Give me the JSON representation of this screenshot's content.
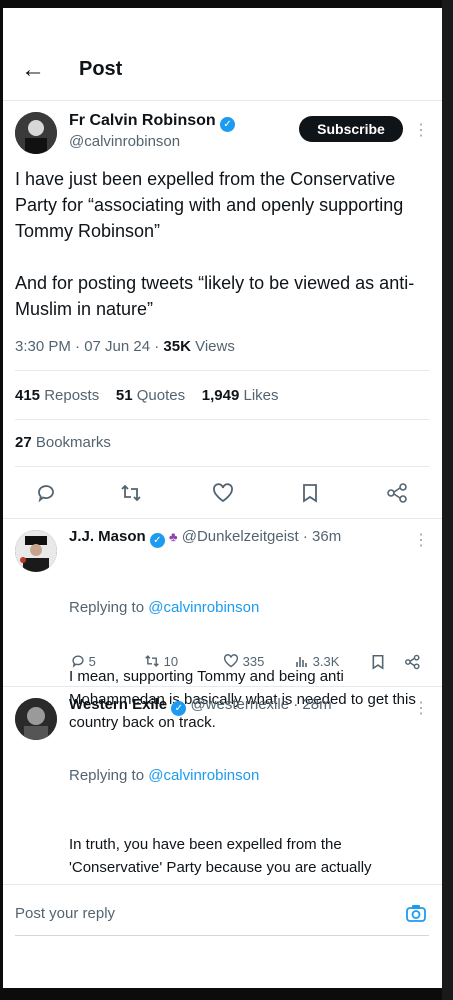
{
  "header": {
    "back_icon": "←",
    "title": "Post"
  },
  "post": {
    "author_name": "Fr Calvin Robinson",
    "author_handle": "@calvinrobinson",
    "subscribe_label": "Subscribe",
    "text": "I have just been expelled from the Conservative Party for “associating with and openly supporting Tommy Robinson”\n\nAnd for posting tweets “likely to be viewed as anti-Muslim in nature”",
    "timestamp": "3:30 PM · 07 Jun 24 · ",
    "views_count": "35K",
    "views_label": " Views",
    "reposts_count": "415",
    "reposts_label": " Reposts",
    "quotes_count": "51",
    "quotes_label": " Quotes",
    "likes_count": "1,949",
    "likes_label": " Likes",
    "bookmarks_count": "27",
    "bookmarks_label": " Bookmarks"
  },
  "replies": [
    {
      "name": "J.J. Mason",
      "handle_time": "@Dunkelzeitgeist · 36m",
      "replying_prefix": "Replying to ",
      "replying_to": "@calvinrobinson",
      "text": "I mean, supporting Tommy and being anti Mohammedan is basically what is needed to get this country back on track.",
      "replies": "5",
      "reposts": "10",
      "likes": "335",
      "views": "3.3K"
    },
    {
      "name": "Western Exile",
      "handle_time": "@westernexile · 28m",
      "replying_prefix": "Replying to ",
      "replying_to": "@calvinrobinson",
      "text": "In truth, you have been expelled from the 'Conservative' Party because you are actually conservative, and therefore exposed the total fraud of that party.\n\nYour honour is intact, and theirs is but ashes"
    }
  ],
  "composer": {
    "placeholder": "Post your reply"
  },
  "colors": {
    "accent": "#1d9bf0",
    "text": "#0f1419",
    "muted": "#536471"
  }
}
